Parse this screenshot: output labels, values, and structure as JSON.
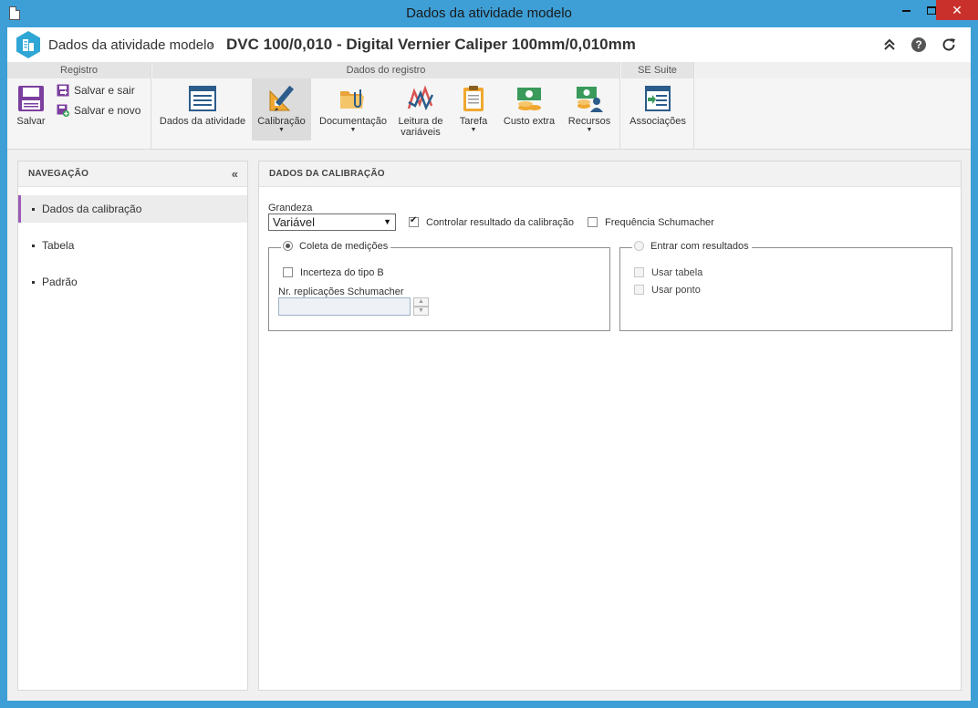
{
  "window": {
    "title": "Dados da atividade modelo"
  },
  "header": {
    "breadcrumb_root": "Dados da atividade modelo",
    "breadcrumb_separator": "›",
    "record_title": "DVC 100/0,010 - Digital Vernier Caliper 100mm/0,010mm"
  },
  "ribbon": {
    "groups": {
      "registro": "Registro",
      "dados_registro": "Dados do registro",
      "se_suite": "SE Suite"
    },
    "salvar": "Salvar",
    "salvar_sair": "Salvar e sair",
    "salvar_novo": "Salvar e novo",
    "dados_atividade": "Dados da atividade",
    "calibracao": "Calibração",
    "documentacao": "Documentação",
    "leitura_line1": "Leitura de",
    "leitura_line2": "variáveis",
    "tarefa": "Tarefa",
    "custo_extra": "Custo extra",
    "recursos": "Recursos",
    "associacoes": "Associações"
  },
  "nav": {
    "title": "NAVEGAÇÃO",
    "items": [
      {
        "label": "Dados da calibração"
      },
      {
        "label": "Tabela"
      },
      {
        "label": "Padrão"
      }
    ]
  },
  "content": {
    "title": "DADOS DA CALIBRAÇÃO",
    "grandeza_label": "Grandeza",
    "grandeza_value": "Variável",
    "controlar_resultado": "Controlar resultado da calibração",
    "controlar_resultado_checked": true,
    "frequencia_schumacher": "Frequência Schumacher",
    "frequencia_schumacher_checked": false,
    "coleta": {
      "legend": "Coleta de medições",
      "selected": true,
      "incerteza": "Incerteza do tipo B",
      "replicacoes_label": "Nr. replicações Schumacher",
      "replicacoes_value": ""
    },
    "entrar": {
      "legend": "Entrar com resultados",
      "selected": false,
      "usar_tabela": "Usar tabela",
      "usar_ponto": "Usar ponto"
    }
  },
  "colors": {
    "window_frame": "#3d9fd6",
    "nav_active_accent": "#9b59b6",
    "close_button": "#c9302c"
  }
}
